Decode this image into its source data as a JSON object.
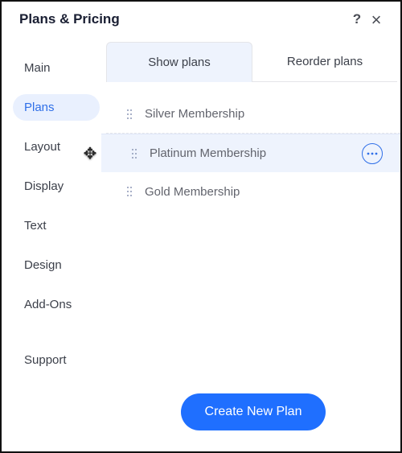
{
  "header": {
    "title": "Plans & Pricing"
  },
  "sidebar": {
    "items": [
      {
        "label": "Main",
        "active": false
      },
      {
        "label": "Plans",
        "active": true
      },
      {
        "label": "Layout",
        "active": false
      },
      {
        "label": "Display",
        "active": false
      },
      {
        "label": "Text",
        "active": false
      },
      {
        "label": "Design",
        "active": false
      },
      {
        "label": "Add-Ons",
        "active": false
      }
    ],
    "support_label": "Support"
  },
  "tabs": {
    "show": "Show plans",
    "reorder": "Reorder plans",
    "active": "show"
  },
  "plans": [
    {
      "label": "Silver Membership",
      "hovered": false
    },
    {
      "label": "Platinum Membership",
      "hovered": true
    },
    {
      "label": "Gold Membership",
      "hovered": false
    }
  ],
  "cta": {
    "label": "Create New Plan"
  }
}
